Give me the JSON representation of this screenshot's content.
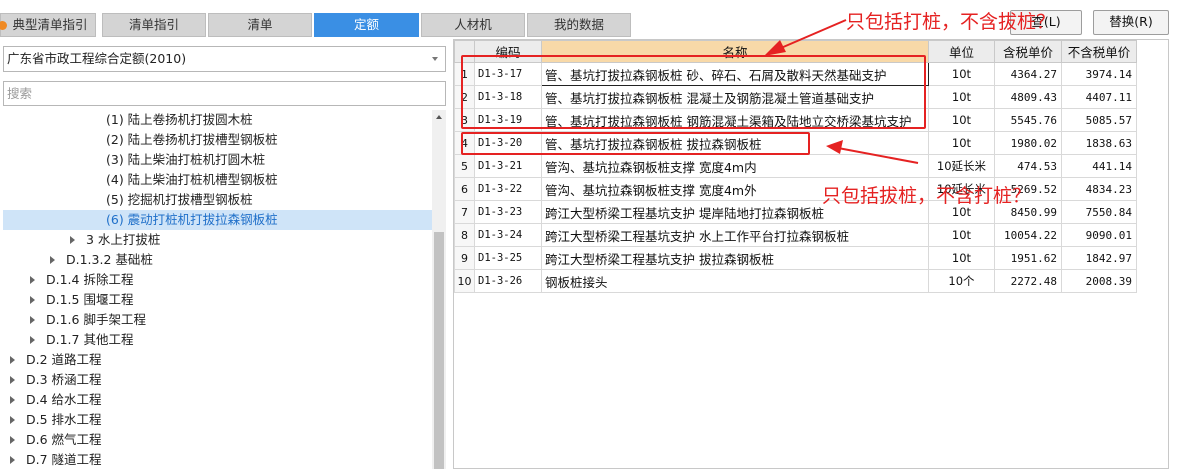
{
  "tabs": [
    {
      "label": "典型清单指引"
    },
    {
      "label": "清单指引"
    },
    {
      "label": "清单"
    },
    {
      "label": "定额"
    },
    {
      "label": "人材机"
    },
    {
      "label": "我的数据"
    }
  ],
  "toolbar": {
    "locate_label": "查(L)",
    "replace_label": "替换(R)"
  },
  "left": {
    "library_selected": "广东省市政工程综合定额(2010)",
    "search_placeholder": "搜索"
  },
  "tree": [
    {
      "label": "(1) 陆上卷扬机打拔圆木桩"
    },
    {
      "label": "(2) 陆上卷扬机打拔槽型钢板桩"
    },
    {
      "label": "(3) 陆上柴油打桩机打圆木桩"
    },
    {
      "label": "(4) 陆上柴油打桩机槽型钢板桩"
    },
    {
      "label": "(5) 挖掘机打拔槽型钢板桩"
    },
    {
      "label": "(6) 震动打桩机打拔拉森钢板桩"
    },
    {
      "label": "3 水上打拔桩"
    },
    {
      "label": "D.1.3.2 基础桩"
    },
    {
      "label": "D.1.4 拆除工程"
    },
    {
      "label": "D.1.5 围堰工程"
    },
    {
      "label": "D.1.6 脚手架工程"
    },
    {
      "label": "D.1.7 其他工程"
    },
    {
      "label": "D.2 道路工程"
    },
    {
      "label": "D.3 桥涵工程"
    },
    {
      "label": "D.4 给水工程"
    },
    {
      "label": "D.5 排水工程"
    },
    {
      "label": "D.6 燃气工程"
    },
    {
      "label": "D.7 隧道工程"
    }
  ],
  "table": {
    "headers": {
      "code": "编码",
      "name": "名称",
      "unit": "单位",
      "taxed": "含税单价",
      "untaxed": "不含税单价"
    },
    "rows": [
      {
        "idx": "1",
        "code": "D1-3-17",
        "name": "管、基坑打拔拉森钢板桩 砂、碎石、石屑及散料天然基础支护",
        "unit": "10t",
        "taxed": "4364.27",
        "untaxed": "3974.14"
      },
      {
        "idx": "2",
        "code": "D1-3-18",
        "name": "管、基坑打拔拉森钢板桩 混凝土及钢筋混凝土管道基础支护",
        "unit": "10t",
        "taxed": "4809.43",
        "untaxed": "4407.11"
      },
      {
        "idx": "3",
        "code": "D1-3-19",
        "name": "管、基坑打拔拉森钢板桩 钢筋混凝土渠箱及陆地立交桥梁基坑支护",
        "unit": "10t",
        "taxed": "5545.76",
        "untaxed": "5085.57"
      },
      {
        "idx": "4",
        "code": "D1-3-20",
        "name": "管、基坑打拔拉森钢板桩 拔拉森钢板桩",
        "unit": "10t",
        "taxed": "1980.02",
        "untaxed": "1838.63"
      },
      {
        "idx": "5",
        "code": "D1-3-21",
        "name": "管沟、基坑拉森钢板桩支撑 宽度4m内",
        "unit": "10延长米",
        "taxed": "474.53",
        "untaxed": "441.14"
      },
      {
        "idx": "6",
        "code": "D1-3-22",
        "name": "管沟、基坑拉森钢板桩支撑 宽度4m外",
        "unit": "10延长米",
        "taxed": "5269.52",
        "untaxed": "4834.23"
      },
      {
        "idx": "7",
        "code": "D1-3-23",
        "name": "跨江大型桥梁工程基坑支护 堤岸陆地打拉森钢板桩",
        "unit": "10t",
        "taxed": "8450.99",
        "untaxed": "7550.84"
      },
      {
        "idx": "8",
        "code": "D1-3-24",
        "name": "跨江大型桥梁工程基坑支护 水上工作平台打拉森钢板桩",
        "unit": "10t",
        "taxed": "10054.22",
        "untaxed": "9090.01"
      },
      {
        "idx": "9",
        "code": "D1-3-25",
        "name": "跨江大型桥梁工程基坑支护 拔拉森钢板桩",
        "unit": "10t",
        "taxed": "1951.62",
        "untaxed": "1842.97"
      },
      {
        "idx": "10",
        "code": "D1-3-26",
        "name": "钢板桩接头",
        "unit": "10个",
        "taxed": "2272.48",
        "untaxed": "2008.39"
      }
    ]
  },
  "annotations": {
    "note_top": "只包括打桩，不含拔桩？",
    "note_bottom": "只包括拔桩，不含打桩？",
    "color": "#e52222"
  },
  "colors": {
    "accent": "#3a8fe4",
    "selected_row": "#cfe4f8",
    "name_header": "#f8d9a8"
  }
}
